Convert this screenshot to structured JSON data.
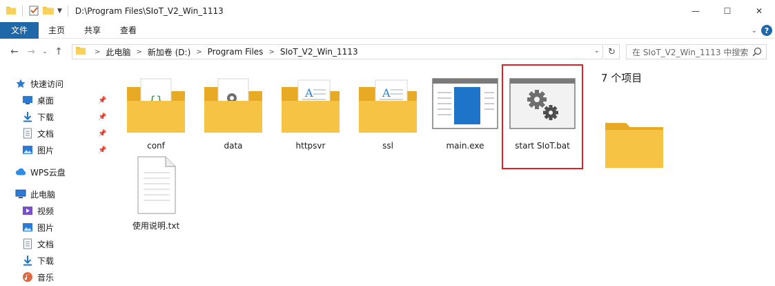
{
  "window": {
    "title": "D:\\Program Files\\SIoT_V2_Win_1113",
    "controls": {
      "minimize": "—",
      "maximize": "☐",
      "close": "✕"
    }
  },
  "ribbon": {
    "tabs": [
      "文件",
      "主页",
      "共享",
      "查看"
    ],
    "help_label": "?"
  },
  "address": {
    "breadcrumbs": [
      "此电脑",
      "新加卷 (D:)",
      "Program Files",
      "SIoT_V2_Win_1113"
    ],
    "search_placeholder": "在 SIoT_V2_Win_1113 中搜索"
  },
  "sidebar": {
    "quick_access": "快速访问",
    "quick_items": [
      "桌面",
      "下载",
      "文档",
      "图片"
    ],
    "wps": "WPS云盘",
    "this_pc": "此电脑",
    "pc_items": [
      "视频",
      "图片",
      "文档",
      "下载",
      "音乐"
    ]
  },
  "files": [
    {
      "name": "conf",
      "kind": "folder-code"
    },
    {
      "name": "data",
      "kind": "folder-gear"
    },
    {
      "name": "httpsvr",
      "kind": "folder-text"
    },
    {
      "name": "ssl",
      "kind": "folder-text"
    },
    {
      "name": "main.exe",
      "kind": "exe"
    },
    {
      "name": "start SIoT.bat",
      "kind": "bat"
    },
    {
      "name": "使用说明.txt",
      "kind": "txt"
    }
  ],
  "details": {
    "item_count": "7 个项目"
  },
  "colors": {
    "accent": "#1e67a8",
    "folder": "#f6c344",
    "highlight": "#e02020"
  }
}
